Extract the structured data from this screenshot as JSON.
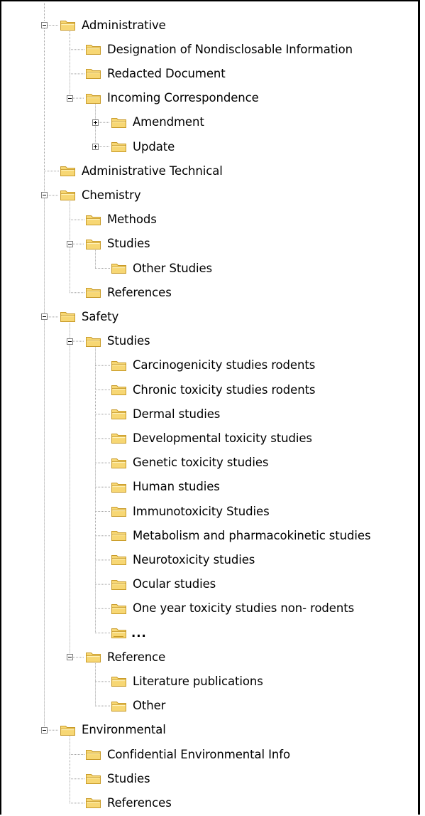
{
  "tree": {
    "nodes": [
      {
        "label": "Administrative",
        "level": 0,
        "expander": "minus"
      },
      {
        "label": "Designation of Nondisclosable Information",
        "level": 1,
        "expander": ""
      },
      {
        "label": "Redacted Document",
        "level": 1,
        "expander": ""
      },
      {
        "label": "Incoming Correspondence",
        "level": 1,
        "expander": "minus"
      },
      {
        "label": "Amendment",
        "level": 2,
        "expander": "plus"
      },
      {
        "label": "Update",
        "level": 2,
        "expander": "plus"
      },
      {
        "label": "Administrative Technical",
        "level": 0,
        "expander": ""
      },
      {
        "label": "Chemistry",
        "level": 0,
        "expander": "minus"
      },
      {
        "label": "Methods",
        "level": 1,
        "expander": ""
      },
      {
        "label": "Studies",
        "level": 1,
        "expander": "minus"
      },
      {
        "label": "Other Studies",
        "level": 2,
        "expander": ""
      },
      {
        "label": "References",
        "level": 1,
        "expander": ""
      },
      {
        "label": "Safety",
        "level": 0,
        "expander": "minus"
      },
      {
        "label": "Studies",
        "level": 1,
        "expander": "minus"
      },
      {
        "label": "Carcinogenicity studies rodents",
        "level": 2,
        "expander": ""
      },
      {
        "label": "Chronic toxicity studies rodents",
        "level": 2,
        "expander": ""
      },
      {
        "label": "Dermal studies",
        "level": 2,
        "expander": ""
      },
      {
        "label": "Developmental toxicity studies",
        "level": 2,
        "expander": ""
      },
      {
        "label": "Genetic toxicity studies",
        "level": 2,
        "expander": ""
      },
      {
        "label": "Human studies",
        "level": 2,
        "expander": ""
      },
      {
        "label": "Immunotoxicity Studies",
        "level": 2,
        "expander": ""
      },
      {
        "label": "Metabolism and pharmacokinetic studies",
        "level": 2,
        "expander": ""
      },
      {
        "label": "Neurotoxicity studies",
        "level": 2,
        "expander": ""
      },
      {
        "label": "Ocular studies",
        "level": 2,
        "expander": ""
      },
      {
        "label": "One year toxicity studies non- rodents",
        "level": 2,
        "expander": ""
      },
      {
        "label": "...",
        "level": 2,
        "expander": ""
      },
      {
        "label": "Reference",
        "level": 1,
        "expander": "minus"
      },
      {
        "label": "Literature publications",
        "level": 2,
        "expander": ""
      },
      {
        "label": "Other",
        "level": 2,
        "expander": ""
      },
      {
        "label": "Environmental",
        "level": 0,
        "expander": "minus"
      },
      {
        "label": "Confidential Environmental Info",
        "level": 1,
        "expander": ""
      },
      {
        "label": "Studies",
        "level": 1,
        "expander": ""
      },
      {
        "label": "References",
        "level": 1,
        "expander": ""
      }
    ]
  },
  "colors": {
    "folder_fill": "#f7d774",
    "folder_edge": "#c89a28",
    "folder_highlight": "#fff2b8",
    "connector": "#a0a0a0",
    "expander_border": "#808080"
  }
}
